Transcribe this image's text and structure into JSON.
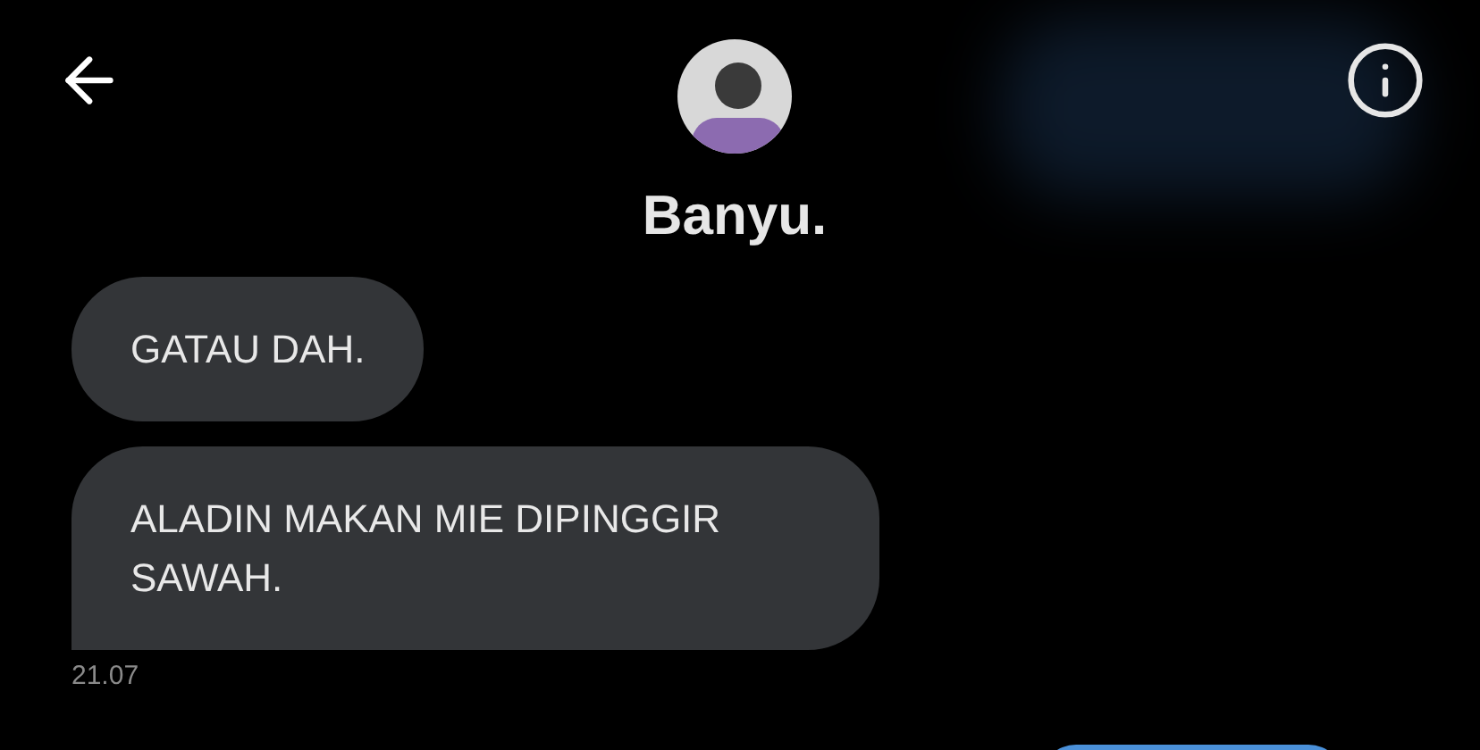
{
  "header": {
    "name": "Banyu."
  },
  "messages": [
    {
      "text": "GATAU DAH.",
      "last": false
    },
    {
      "text": "ALADIN MAKAN MIE DIPINGGIR SAWAH.",
      "last": true
    }
  ],
  "timestamp": "21.07"
}
